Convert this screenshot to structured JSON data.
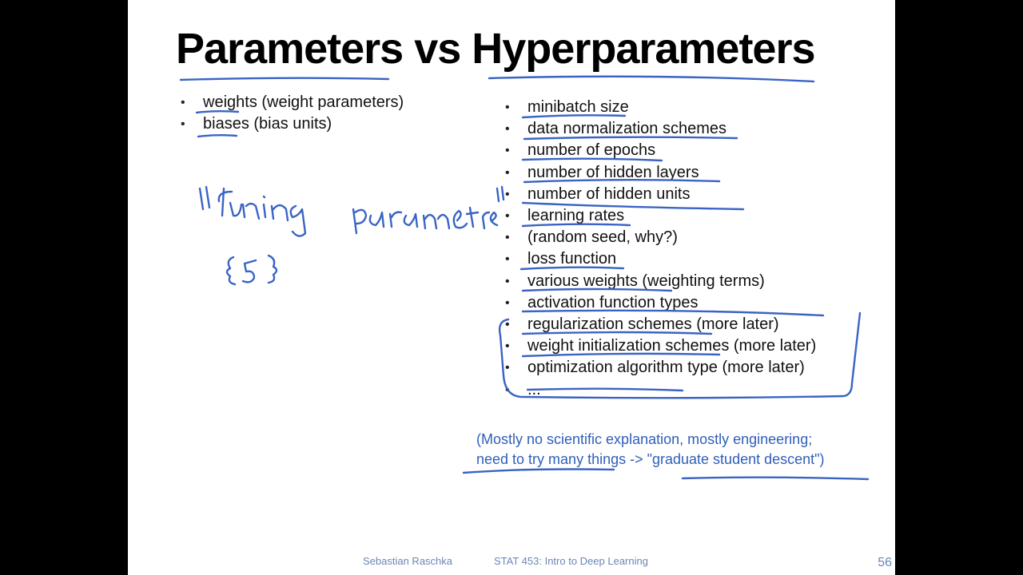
{
  "slide": {
    "title": "Parameters vs Hyperparameters",
    "parameters": [
      {
        "term": "weights",
        "rest": " (weight parameters)"
      },
      {
        "term": "biases",
        "rest": " (bias units)"
      }
    ],
    "hyperparameters": [
      "minibatch size",
      "data normalization schemes",
      "number of epochs",
      "number of hidden layers",
      "number of hidden units",
      "learning rates",
      "(random seed, why?)",
      "loss function",
      "various weights (weighting terms)",
      "activation function types",
      "regularization schemes (more later)",
      "weight initialization schemes (more later)",
      "optimization algorithm type (more later)",
      "..."
    ],
    "note_lines": [
      "(Mostly no scientific explanation, mostly engineering;",
      "need to try many things -> \"graduate student descent\")"
    ],
    "handwriting": "\"tuning parameters\"",
    "footer": {
      "author": "Sebastian Raschka",
      "course": "STAT 453: Intro to Deep Learning",
      "page": "56"
    }
  },
  "colors": {
    "ink": "#3a64c4",
    "note_text": "#2f5fb8",
    "footer_text": "#6b86b5",
    "letterbox": "#000000"
  }
}
